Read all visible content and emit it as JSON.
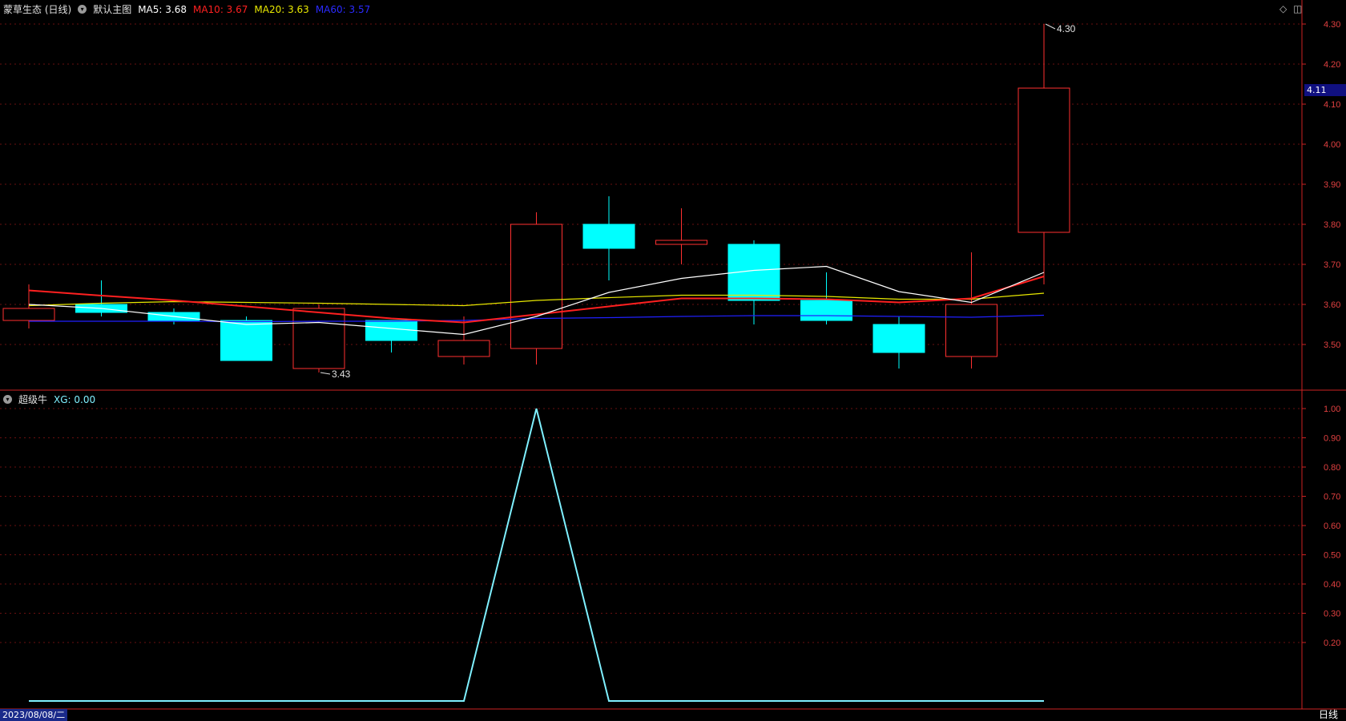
{
  "header": {
    "stock_label": "蒙草生态 (日线)",
    "main_chart_label": "默认主图",
    "ma5": "MA5: 3.68",
    "ma10": "MA10: 3.67",
    "ma20": "MA20: 3.63",
    "ma60": "MA60: 3.57"
  },
  "indicator_header": {
    "name": "超级牛",
    "value": "XG: 0.00"
  },
  "colors": {
    "up": "#ff3030",
    "down": "#00ffff",
    "ma5": "#ffffff",
    "ma10": "#ff2020",
    "ma20": "#e8e800",
    "ma60": "#2020ff",
    "xg": "#7ff0ff",
    "axis": "#cc2222"
  },
  "price_tag": "4.11",
  "date_label": "2023/08/08/二",
  "period_label": "日线",
  "chart_data": [
    {
      "type": "candlestick",
      "y_ticks": [
        "4.30",
        "4.20",
        "4.10",
        "4.00",
        "3.90",
        "3.80",
        "3.70",
        "3.60",
        "3.50"
      ],
      "ylim": [
        3.42,
        4.32
      ],
      "candles": [
        {
          "open": 3.56,
          "close": 3.59,
          "high": 3.65,
          "low": 3.54
        },
        {
          "open": 3.6,
          "close": 3.58,
          "high": 3.66,
          "low": 3.57
        },
        {
          "open": 3.58,
          "close": 3.56,
          "high": 3.59,
          "low": 3.55
        },
        {
          "open": 3.56,
          "close": 3.46,
          "high": 3.57,
          "low": 3.46
        },
        {
          "open": 3.44,
          "close": 3.59,
          "high": 3.6,
          "low": 3.43
        },
        {
          "open": 3.56,
          "close": 3.51,
          "high": 3.56,
          "low": 3.48
        },
        {
          "open": 3.47,
          "close": 3.51,
          "high": 3.57,
          "low": 3.45
        },
        {
          "open": 3.49,
          "close": 3.8,
          "high": 3.83,
          "low": 3.45
        },
        {
          "open": 3.8,
          "close": 3.74,
          "high": 3.87,
          "low": 3.66
        },
        {
          "open": 3.75,
          "close": 3.76,
          "high": 3.84,
          "low": 3.7
        },
        {
          "open": 3.75,
          "close": 3.61,
          "high": 3.76,
          "low": 3.55
        },
        {
          "open": 3.61,
          "close": 3.56,
          "high": 3.68,
          "low": 3.55
        },
        {
          "open": 3.55,
          "close": 3.48,
          "high": 3.57,
          "low": 3.44
        },
        {
          "open": 3.47,
          "close": 3.6,
          "high": 3.73,
          "low": 3.44
        },
        {
          "open": 3.78,
          "close": 4.14,
          "high": 4.3,
          "low": 3.65
        }
      ],
      "ma5": [
        3.6,
        3.59,
        3.57,
        3.55,
        3.555,
        3.54,
        3.525,
        3.57,
        3.63,
        3.665,
        3.685,
        3.695,
        3.632,
        3.605,
        3.68
      ],
      "ma10": [
        3.635,
        3.622,
        3.61,
        3.595,
        3.58,
        3.565,
        3.555,
        3.575,
        3.595,
        3.615,
        3.615,
        3.613,
        3.605,
        3.615,
        3.67
      ],
      "ma20": [
        3.597,
        3.603,
        3.607,
        3.605,
        3.603,
        3.6,
        3.597,
        3.61,
        3.617,
        3.623,
        3.623,
        3.62,
        3.613,
        3.613,
        3.628
      ],
      "ma60": [
        3.558,
        3.558,
        3.558,
        3.557,
        3.558,
        3.558,
        3.56,
        3.565,
        3.567,
        3.57,
        3.572,
        3.572,
        3.57,
        3.568,
        3.573
      ],
      "annotations": [
        {
          "text": "4.30",
          "value": 4.3,
          "candle": 14
        },
        {
          "text": "3.43",
          "value": 3.43,
          "candle": 4
        }
      ]
    },
    {
      "type": "line",
      "name": "XG",
      "y_ticks": [
        "1.00",
        "0.90",
        "0.80",
        "0.70",
        "0.60",
        "0.50",
        "0.40",
        "0.30",
        "0.20"
      ],
      "ylim": [
        0,
        1
      ],
      "values": [
        0,
        0,
        0,
        0,
        0,
        0,
        0,
        1,
        0,
        0,
        0,
        0,
        0,
        0,
        0
      ]
    }
  ]
}
